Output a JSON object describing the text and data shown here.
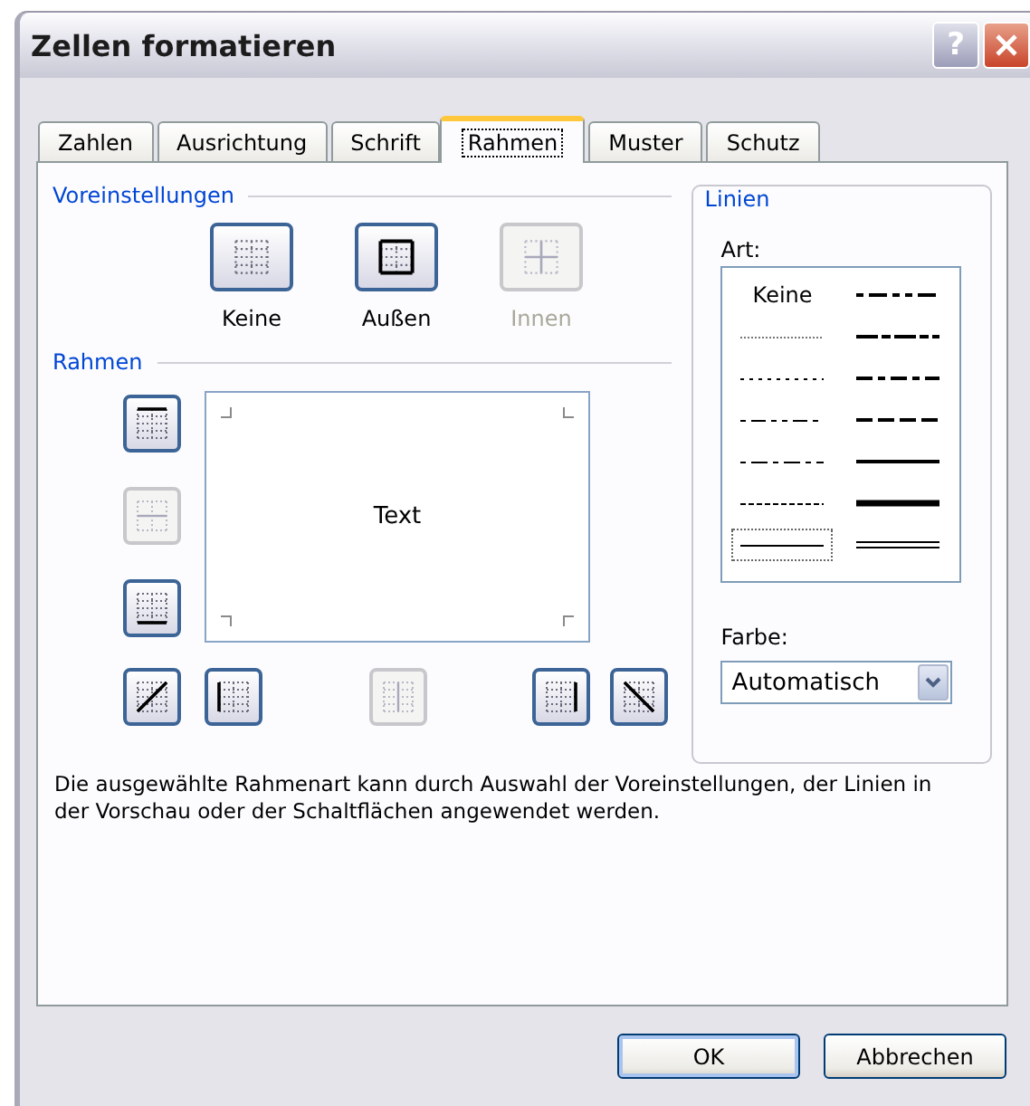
{
  "window": {
    "title": "Zellen formatieren",
    "help_glyph": "?"
  },
  "tabs": [
    {
      "label": "Zahlen",
      "selected": false
    },
    {
      "label": "Ausrichtung",
      "selected": false
    },
    {
      "label": "Schrift",
      "selected": false
    },
    {
      "label": "Rahmen",
      "selected": true
    },
    {
      "label": "Muster",
      "selected": false
    },
    {
      "label": "Schutz",
      "selected": false
    }
  ],
  "presets": {
    "title": "Voreinstellungen",
    "items": [
      {
        "kind": "none",
        "label": "Keine",
        "disabled": false
      },
      {
        "kind": "outline",
        "label": "Außen",
        "disabled": false
      },
      {
        "kind": "inside",
        "label": "Innen",
        "disabled": true
      }
    ]
  },
  "border": {
    "title": "Rahmen",
    "preview_text": "Text",
    "buttons": [
      {
        "kind": "top",
        "disabled": false
      },
      {
        "kind": "middle_h",
        "disabled": true
      },
      {
        "kind": "bottom",
        "disabled": false
      },
      {
        "kind": "diag_up",
        "disabled": false
      },
      {
        "kind": "left",
        "disabled": false
      },
      {
        "kind": "middle_v",
        "disabled": true
      },
      {
        "kind": "right",
        "disabled": false
      },
      {
        "kind": "diag_down",
        "disabled": false
      }
    ]
  },
  "lines": {
    "title": "Linien",
    "style_label": "Art:",
    "styles": [
      {
        "kind": "none",
        "label": "Keine",
        "selected": false
      },
      {
        "kind": "hair",
        "selected": false
      },
      {
        "kind": "dotted",
        "selected": false
      },
      {
        "kind": "dash_dot_dot",
        "selected": false
      },
      {
        "kind": "dash_dot",
        "selected": false
      },
      {
        "kind": "dashed",
        "selected": false
      },
      {
        "kind": "thin",
        "selected": true
      },
      {
        "kind": "medium_dash_dot_dot",
        "selected": false
      },
      {
        "kind": "slant_dash_dot",
        "selected": false
      },
      {
        "kind": "medium_dash_dot",
        "selected": false
      },
      {
        "kind": "medium_dashed",
        "selected": false
      },
      {
        "kind": "medium",
        "selected": false
      },
      {
        "kind": "thick",
        "selected": false
      },
      {
        "kind": "double",
        "selected": false
      }
    ],
    "color_label": "Farbe:",
    "color_value": "Automatisch"
  },
  "description": "Die ausgewählte Rahmenart kann durch Auswahl der Voreinstellungen, der Linien in der Vorschau oder der Schaltflächen angewendet werden.",
  "buttons": [
    {
      "label": "OK",
      "default": true
    },
    {
      "label": "Abbrechen",
      "default": false
    }
  ]
}
